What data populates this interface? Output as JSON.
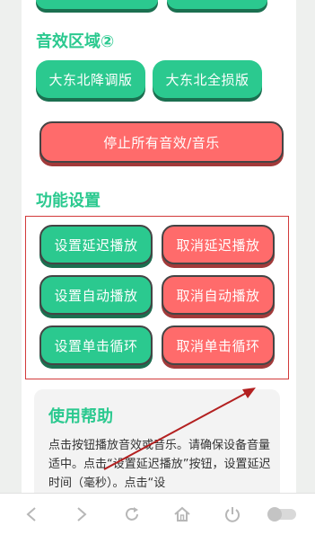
{
  "sections": {
    "sound_area_2": {
      "title": "音效区域②",
      "buttons": [
        "大东北降调版",
        "大东北全损版"
      ]
    },
    "stop_all": "停止所有音效/音乐",
    "functions": {
      "title": "功能设置",
      "rows": [
        {
          "set": "设置延迟播放",
          "cancel": "取消延迟播放"
        },
        {
          "set": "设置自动播放",
          "cancel": "取消自动播放"
        },
        {
          "set": "设置单击循环",
          "cancel": "取消单击循环"
        }
      ]
    },
    "help": {
      "title": "使用帮助",
      "text": "点击按钮播放音效或音乐。请确保设备音量适中。点击“设置延迟播放”按钮，设置延迟时间（毫秒）。点击“设"
    }
  },
  "nav_icons": [
    "back-icon",
    "forward-icon",
    "refresh-icon",
    "home-icon",
    "power-icon",
    "toggle-icon"
  ],
  "colors": {
    "accent": "#2bc98f",
    "danger": "#ff6b6b",
    "annotation": "#b32020"
  }
}
